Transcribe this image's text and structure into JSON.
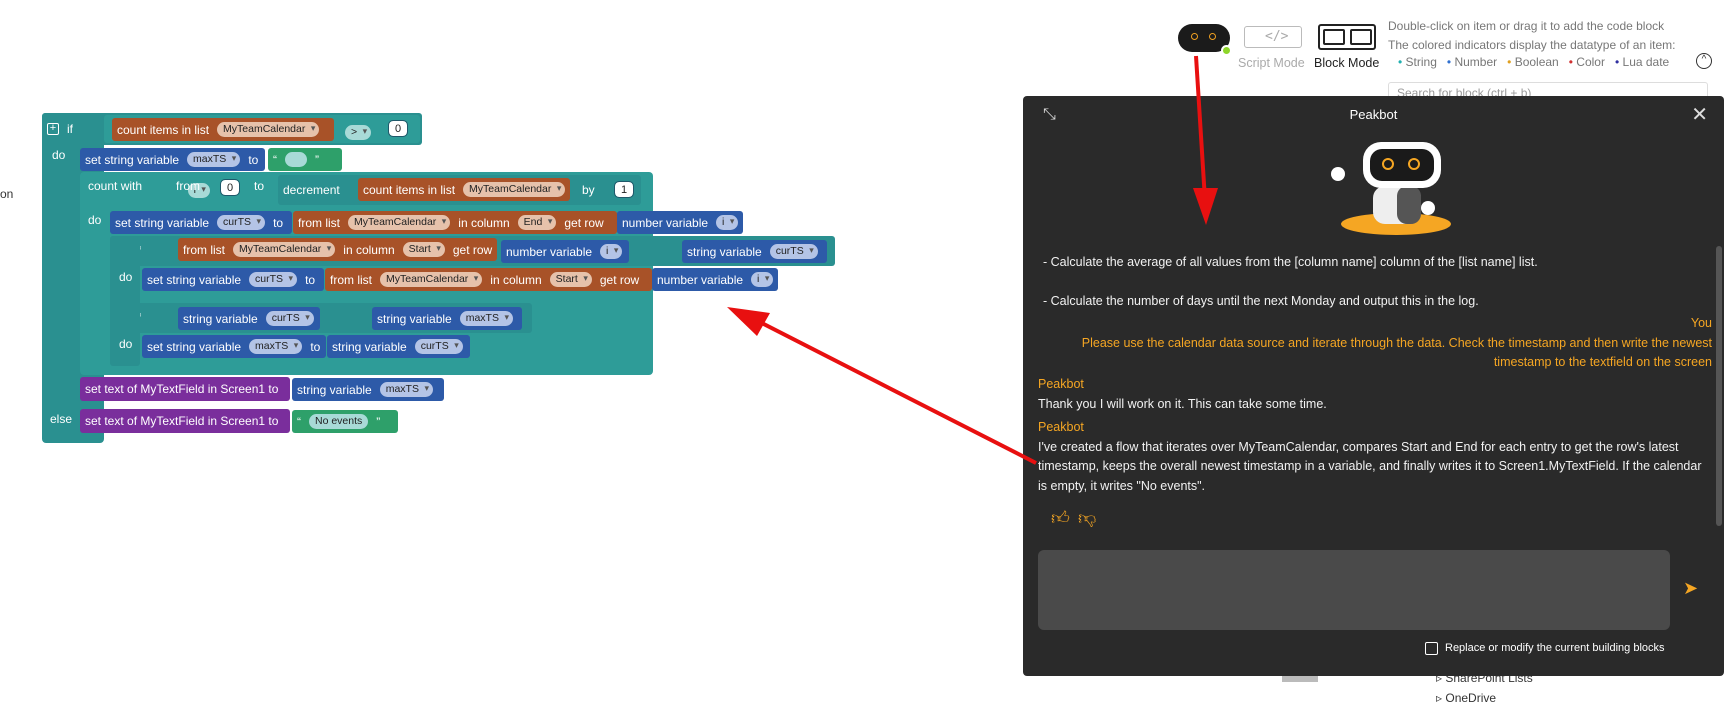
{
  "workspace": {
    "cut_text": "on",
    "if_label": "if",
    "do_label": "do",
    "else_label": "else",
    "count_items_label": "count items in list",
    "list_name": "MyTeamCalendar",
    "gt_op": ">",
    "zero": "0",
    "one": "1",
    "set_string_var_label": "set string variable",
    "to_label": "to",
    "quote_open": "“",
    "quote_close": "”",
    "var_maxTS": "maxTS",
    "var_curTS": "curTS",
    "var_i": "i",
    "count_with_label": "count with",
    "from_label": "from",
    "decrement_label": "decrement",
    "by_label": "by",
    "from_list_label": "from list",
    "in_column_label": "in column",
    "get_row_label": "get row",
    "col_end": "End",
    "col_start": "Start",
    "number_variable_label": "number variable",
    "string_variable_label": "string variable",
    "set_text_label": "set text of MyTextField in Screen1 to",
    "no_events": "No events"
  },
  "toolbar": {
    "script_mode": "Script Mode",
    "block_mode": "Block Mode",
    "hint_line1": "Double-click on item or drag it to add the code block",
    "hint_line2": "The colored indicators display the datatype of an item:",
    "types": [
      {
        "label": "String",
        "color": "#20b0b0"
      },
      {
        "label": "Number",
        "color": "#3070d0"
      },
      {
        "label": "Boolean",
        "color": "#e0a020"
      },
      {
        "label": "Color",
        "color": "#d03030"
      },
      {
        "label": "Lua date",
        "color": "#3030a0"
      }
    ],
    "search_placeholder": "Search for block (ctrl + b)",
    "sidebar_items": [
      "SharePoint Lists",
      "OneDrive"
    ]
  },
  "chat": {
    "title": "Peakbot",
    "line_avg": "- Calculate the average of all values from the [column name] column of the [list name] list.",
    "line_days": "- Calculate the number of days until the next Monday and output this in the log.",
    "you_label": "You",
    "user_msg_1": "Please use the calendar data source and iterate through the data. Check the timestamp and then write the newest",
    "user_msg_2": "timestamp to the textfield on the screen",
    "bot_label_1": "Peakbot",
    "bot_msg_1": "Thank you I will work on it. This can take some time.",
    "bot_label_2": "Peakbot",
    "bot_msg_2a": "I've created a flow that iterates over MyTeamCalendar, compares Start and End for each entry to get the row's latest",
    "bot_msg_2b": "timestamp, keeps the overall newest timestamp in a variable, and finally writes it to Screen1.MyTextField. If the calendar",
    "bot_msg_2c": "is empty, it writes \"No events\".",
    "input_value": "",
    "replace_label": "Replace or modify the current building blocks",
    "accent": "#f5a623"
  }
}
